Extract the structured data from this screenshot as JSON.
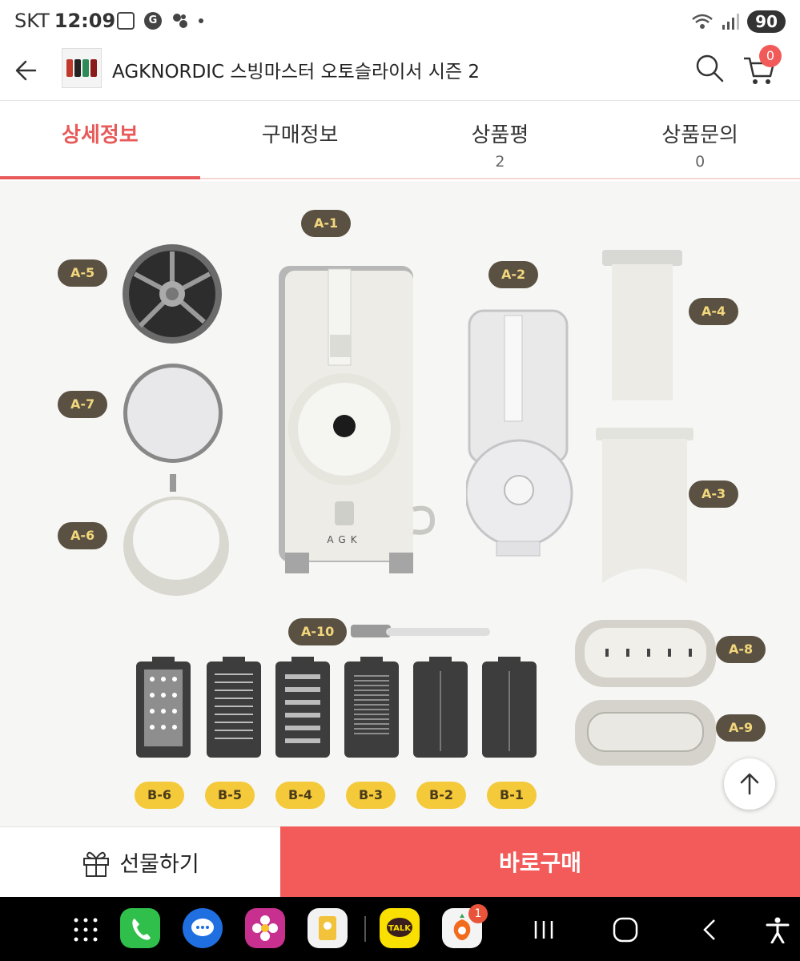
{
  "status_bar": {
    "carrier": "SKT",
    "time": "12:09",
    "battery": "90"
  },
  "header": {
    "title": "AGKNORDIC 스빙마스터 오토슬라이서 시즌 2",
    "cart_count": "0"
  },
  "tabs": [
    {
      "label": "상세정보",
      "count": ""
    },
    {
      "label": "구매정보",
      "count": ""
    },
    {
      "label": "상품평",
      "count": "2"
    },
    {
      "label": "상품문의",
      "count": "0"
    }
  ],
  "parts": {
    "a1": "A-1",
    "a2": "A-2",
    "a3": "A-3",
    "a4": "A-4",
    "a5": "A-5",
    "a6": "A-6",
    "a7": "A-7",
    "a8": "A-8",
    "a9": "A-9",
    "a10": "A-10",
    "b1": "B-1",
    "b2": "B-2",
    "b3": "B-3",
    "b4": "B-4",
    "b5": "B-5",
    "b6": "B-6",
    "body_logo": "AGK"
  },
  "bottom": {
    "gift_label": "선물하기",
    "buy_label": "바로구매"
  },
  "nav": {
    "kakao_label": "TALK",
    "carrot_badge": "1"
  },
  "colors": {
    "accent": "#e85a5a",
    "buy_bg": "#f35a5a",
    "label_bg": "#5a5143",
    "label_text": "#f2d77c",
    "b_label_bg": "#f4c93a"
  }
}
